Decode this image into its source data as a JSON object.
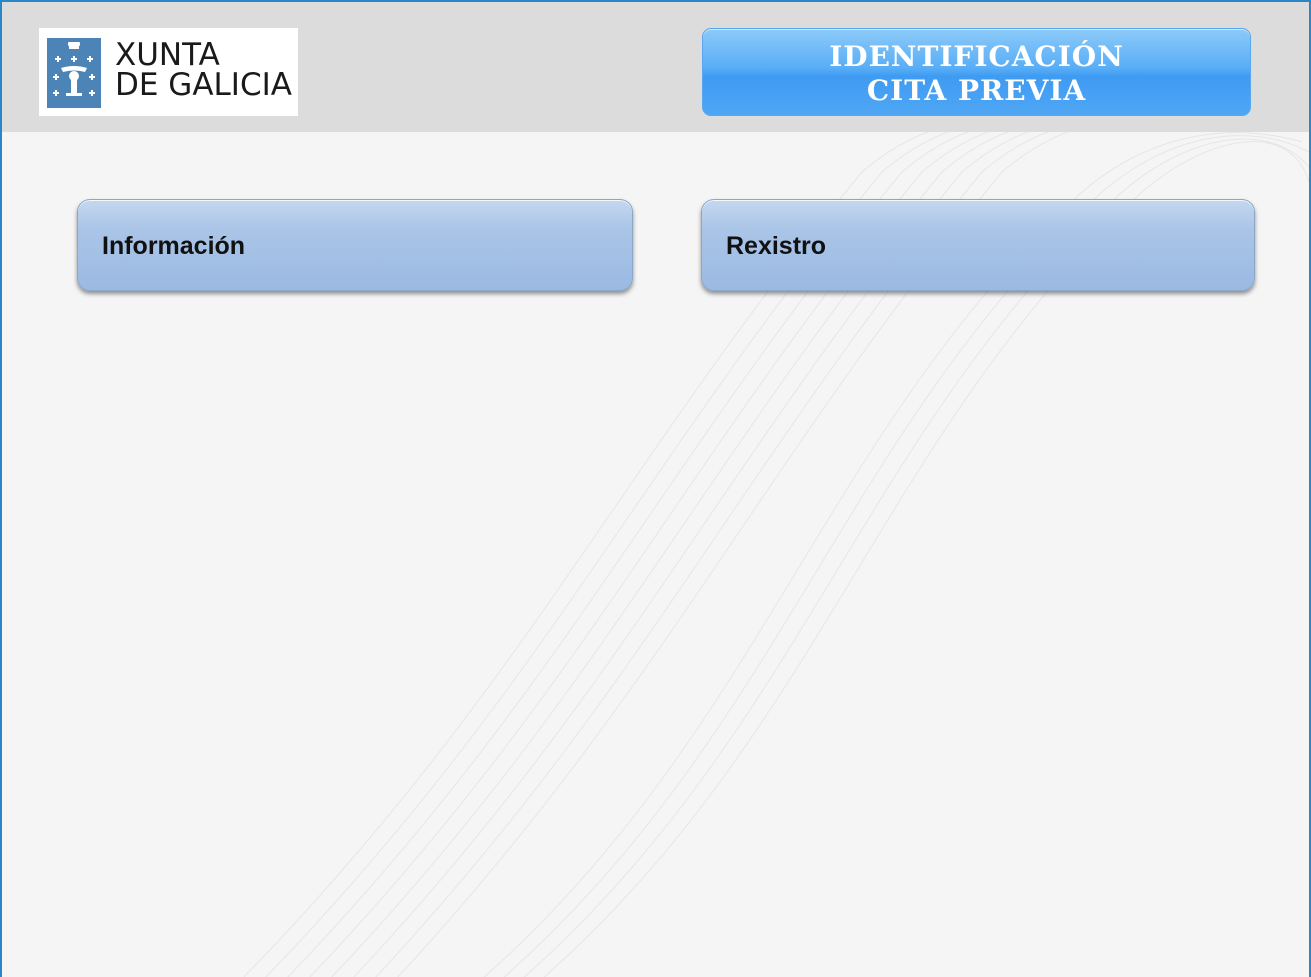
{
  "logo": {
    "line1": "XUNTA",
    "line2": "DE GALICIA",
    "emblem_icon": "galicia-coat-of-arms-icon"
  },
  "title": {
    "line1": "IDENTIFICACIÓN",
    "line2": "CITA PREVIA"
  },
  "menu": {
    "items": [
      {
        "label": "Información"
      },
      {
        "label": "Rexistro"
      }
    ]
  },
  "colors": {
    "border": "#2b86c6",
    "header_bg": "#dcdcdc",
    "page_bg": "#f5f5f5",
    "title_blue": "#4fa6f5",
    "button_blue": "#a9c4e7"
  }
}
